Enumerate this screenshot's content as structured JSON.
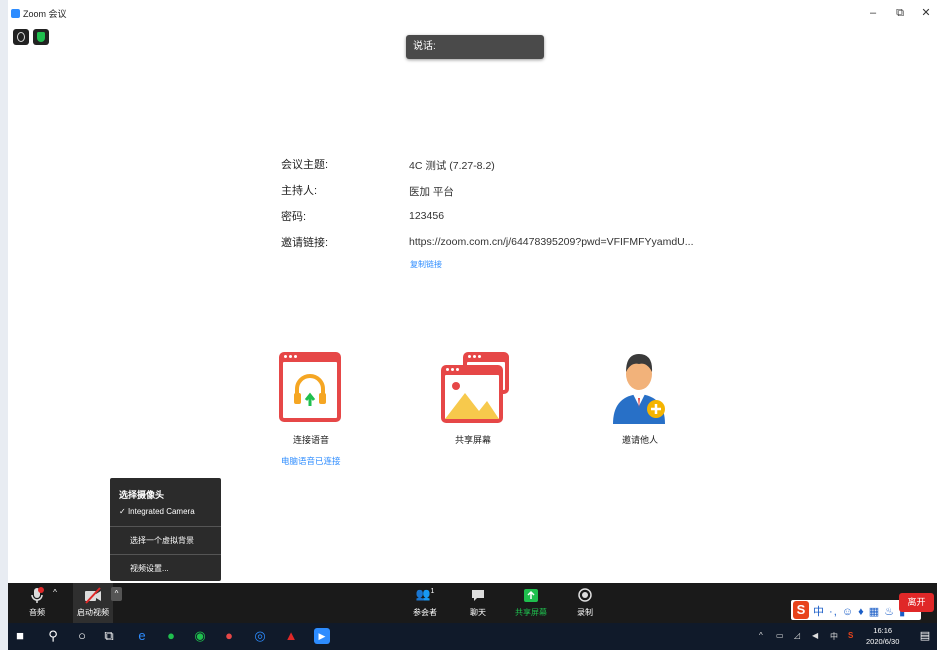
{
  "window": {
    "title": "Zoom 会议"
  },
  "speaker": {
    "label": "说话:"
  },
  "meeting": {
    "topic_label": "会议主题:",
    "topic_value": "4C 测试 (7.27-8.2)",
    "host_label": "主持人:",
    "host_value": "医加 平台",
    "password_label": "密码:",
    "password_value": "123456",
    "link_label": "邀请链接:",
    "link_value": "https://zoom.com.cn/j/64478395209?pwd=VFIFMFYyamdU...",
    "copy_link": "复制链接"
  },
  "actions": [
    {
      "label": "连接语音",
      "sub": "电脑语音已连接"
    },
    {
      "label": "共享屏幕"
    },
    {
      "label": "邀请他人"
    }
  ],
  "camera_menu": {
    "header": "选择摄像头",
    "camera": "Integrated Camera",
    "virtual_bg": "选择一个虚拟背景",
    "video_settings": "视频设置..."
  },
  "toolbar": {
    "audio": "音频",
    "start_video": "启动视频",
    "participants": "参会者",
    "participants_count": "1",
    "chat": "聊天",
    "share": "共享屏幕",
    "record": "录制",
    "leave": "离开"
  },
  "ime": {
    "text": "中 ·, ☺ ♦ ▦ ♨ ▮"
  },
  "taskbar": {
    "tray_lang": "中",
    "time": "16:16",
    "date": "2020/6/30"
  },
  "colors": {
    "accent": "#2d8cff",
    "tile_red": "#e64747",
    "share_green": "#1fbf4e",
    "leave_red": "#e02828"
  }
}
